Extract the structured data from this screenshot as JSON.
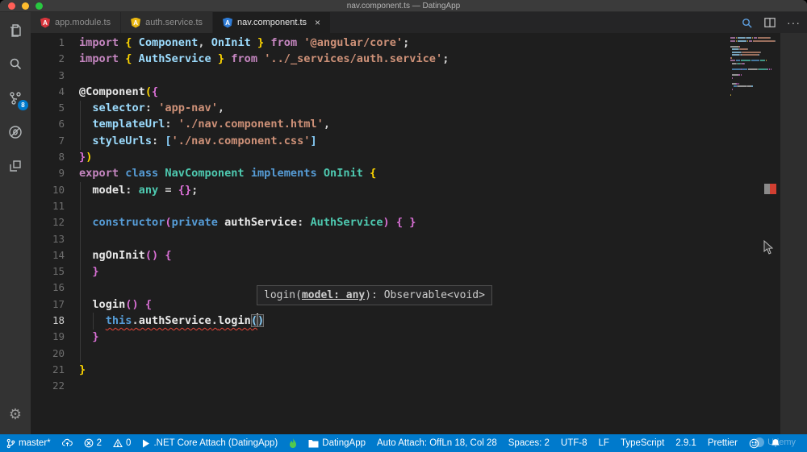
{
  "window": {
    "title": "nav.component.ts — DatingApp"
  },
  "tabs": [
    {
      "label": "app.module.ts",
      "icon_color": "#d8353c",
      "active": false
    },
    {
      "label": "auth.service.ts",
      "icon_color": "#e9b711",
      "active": false
    },
    {
      "label": "nav.component.ts",
      "icon_color": "#2f7cd6",
      "active": true,
      "close_label": "×"
    }
  ],
  "activity_bar": {
    "badge_count": "8",
    "items": [
      "explorer",
      "search",
      "source-control",
      "debug",
      "extensions"
    ],
    "settings": "gear"
  },
  "editor_actions": [
    "open-preview",
    "split-editor",
    "more-actions"
  ],
  "editor": {
    "active_line": 18,
    "lines": [
      {
        "tokens": [
          {
            "t": "import",
            "c": "kwp"
          },
          {
            "t": " ",
            "c": "pu"
          },
          {
            "t": "{",
            "c": "bg"
          },
          {
            "t": " ",
            "c": "pu"
          },
          {
            "t": "Component",
            "c": "vb"
          },
          {
            "t": ", ",
            "c": "pu"
          },
          {
            "t": "OnInit",
            "c": "vb"
          },
          {
            "t": " ",
            "c": "pu"
          },
          {
            "t": "}",
            "c": "bg"
          },
          {
            "t": " ",
            "c": "pu"
          },
          {
            "t": "from",
            "c": "kwp"
          },
          {
            "t": " ",
            "c": "pu"
          },
          {
            "t": "'@angular/core'",
            "c": "str"
          },
          {
            "t": ";",
            "c": "pu"
          }
        ]
      },
      {
        "tokens": [
          {
            "t": "import",
            "c": "kwp"
          },
          {
            "t": " ",
            "c": "pu"
          },
          {
            "t": "{",
            "c": "bg"
          },
          {
            "t": " ",
            "c": "pu"
          },
          {
            "t": "AuthService",
            "c": "vb"
          },
          {
            "t": " ",
            "c": "pu"
          },
          {
            "t": "}",
            "c": "bg"
          },
          {
            "t": " ",
            "c": "pu"
          },
          {
            "t": "from",
            "c": "kwp"
          },
          {
            "t": " ",
            "c": "pu"
          },
          {
            "t": "'../_services/auth.service'",
            "c": "str"
          },
          {
            "t": ";",
            "c": "pu"
          }
        ]
      },
      {
        "tokens": []
      },
      {
        "tokens": [
          {
            "t": "@Component",
            "c": "fn"
          },
          {
            "t": "(",
            "c": "bg"
          },
          {
            "t": "{",
            "c": "bp"
          }
        ]
      },
      {
        "tokens": [
          {
            "t": "  ",
            "c": "pu"
          },
          {
            "t": "selector",
            "c": "vb"
          },
          {
            "t": ": ",
            "c": "pu"
          },
          {
            "t": "'app-nav'",
            "c": "str"
          },
          {
            "t": ",",
            "c": "pu"
          }
        ]
      },
      {
        "tokens": [
          {
            "t": "  ",
            "c": "pu"
          },
          {
            "t": "templateUrl",
            "c": "vb"
          },
          {
            "t": ": ",
            "c": "pu"
          },
          {
            "t": "'./nav.component.html'",
            "c": "str"
          },
          {
            "t": ",",
            "c": "pu"
          }
        ]
      },
      {
        "tokens": [
          {
            "t": "  ",
            "c": "pu"
          },
          {
            "t": "styleUrls",
            "c": "vb"
          },
          {
            "t": ": ",
            "c": "pu"
          },
          {
            "t": "[",
            "c": "bb"
          },
          {
            "t": "'./nav.component.css'",
            "c": "str"
          },
          {
            "t": "]",
            "c": "bb"
          }
        ]
      },
      {
        "tokens": [
          {
            "t": "}",
            "c": "bp"
          },
          {
            "t": ")",
            "c": "bg"
          }
        ]
      },
      {
        "tokens": [
          {
            "t": "export",
            "c": "kwp"
          },
          {
            "t": " ",
            "c": "pu"
          },
          {
            "t": "class",
            "c": "kwb"
          },
          {
            "t": " ",
            "c": "pu"
          },
          {
            "t": "NavComponent",
            "c": "typ"
          },
          {
            "t": " ",
            "c": "pu"
          },
          {
            "t": "implements",
            "c": "kwb"
          },
          {
            "t": " ",
            "c": "pu"
          },
          {
            "t": "OnInit",
            "c": "typ"
          },
          {
            "t": " ",
            "c": "pu"
          },
          {
            "t": "{",
            "c": "bg"
          }
        ]
      },
      {
        "tokens": [
          {
            "t": "  ",
            "c": "pu"
          },
          {
            "t": "model",
            "c": "fn"
          },
          {
            "t": ": ",
            "c": "pu"
          },
          {
            "t": "any",
            "c": "typ"
          },
          {
            "t": " = ",
            "c": "pu"
          },
          {
            "t": "{}",
            "c": "bp"
          },
          {
            "t": ";",
            "c": "pu"
          }
        ]
      },
      {
        "tokens": []
      },
      {
        "tokens": [
          {
            "t": "  ",
            "c": "pu"
          },
          {
            "t": "constructor",
            "c": "kwb"
          },
          {
            "t": "(",
            "c": "bp"
          },
          {
            "t": "private",
            "c": "kwb"
          },
          {
            "t": " ",
            "c": "pu"
          },
          {
            "t": "authService",
            "c": "fn"
          },
          {
            "t": ": ",
            "c": "pu"
          },
          {
            "t": "AuthService",
            "c": "typ"
          },
          {
            "t": ")",
            "c": "bp"
          },
          {
            "t": " ",
            "c": "pu"
          },
          {
            "t": "{",
            "c": "bp"
          },
          {
            "t": " ",
            "c": "pu"
          },
          {
            "t": "}",
            "c": "bp"
          }
        ]
      },
      {
        "tokens": []
      },
      {
        "tokens": [
          {
            "t": "  ",
            "c": "pu"
          },
          {
            "t": "ngOnInit",
            "c": "fn"
          },
          {
            "t": "()",
            "c": "bp"
          },
          {
            "t": " ",
            "c": "pu"
          },
          {
            "t": "{",
            "c": "bp"
          }
        ]
      },
      {
        "tokens": [
          {
            "t": "  ",
            "c": "pu"
          },
          {
            "t": "}",
            "c": "bp"
          }
        ]
      },
      {
        "tokens": []
      },
      {
        "tokens": [
          {
            "t": "  ",
            "c": "pu"
          },
          {
            "t": "login",
            "c": "fn"
          },
          {
            "t": "()",
            "c": "bp"
          },
          {
            "t": " ",
            "c": "pu"
          },
          {
            "t": "{",
            "c": "bp"
          }
        ]
      },
      {
        "tokens": [
          {
            "t": "    ",
            "c": "pu"
          },
          {
            "t": "this",
            "c": "kwb",
            "u": 1
          },
          {
            "t": ".",
            "c": "pu",
            "u": 1
          },
          {
            "t": "authService",
            "c": "fn",
            "u": 1
          },
          {
            "t": ".",
            "c": "pu",
            "u": 1
          },
          {
            "t": "login",
            "c": "fn",
            "u": 1
          },
          {
            "t": "(",
            "c": "bb",
            "m": 1,
            "u": 1
          },
          {
            "cur": 1
          },
          {
            "t": ")",
            "c": "bb",
            "m": 1
          }
        ]
      },
      {
        "tokens": [
          {
            "t": "  ",
            "c": "pu"
          },
          {
            "t": "}",
            "c": "bp"
          }
        ]
      },
      {
        "tokens": []
      },
      {
        "tokens": [
          {
            "t": "}",
            "c": "bg"
          }
        ]
      },
      {
        "tokens": []
      }
    ]
  },
  "tooltip": {
    "pre": "login(",
    "param": "model: any",
    "post": "): Observable<void>"
  },
  "status_left": [
    {
      "icon": "branch",
      "text": "master*"
    },
    {
      "icon": "publish",
      "text": ""
    },
    {
      "icon": "errors",
      "text": "2"
    },
    {
      "icon": "warnings",
      "text": "0"
    },
    {
      "icon": "play",
      "text": ".NET Core Attach (DatingApp)"
    },
    {
      "icon": "flame",
      "text": ""
    },
    {
      "icon": "folder",
      "text": "DatingApp"
    },
    {
      "icon": "",
      "text": "Auto Attach: Off"
    }
  ],
  "status_right": [
    {
      "icon": "",
      "text": "Ln 18, Col 28"
    },
    {
      "icon": "",
      "text": "Spaces: 2"
    },
    {
      "icon": "",
      "text": "UTF-8"
    },
    {
      "icon": "",
      "text": "LF"
    },
    {
      "icon": "",
      "text": "TypeScript"
    },
    {
      "icon": "",
      "text": "2.9.1"
    },
    {
      "icon": "",
      "text": "Prettier"
    },
    {
      "icon": "smiley",
      "text": ""
    },
    {
      "icon": "bell",
      "text": ""
    }
  ],
  "watermark": {
    "text": "Udemy"
  },
  "colors": {
    "status_bar": "#007acc",
    "editor_bg": "#1e1e1e",
    "activity_bar": "#333333",
    "error_marker": "#d23f31",
    "badge": "#007acc",
    "token_map": {
      "kwp": "#c586c0",
      "kwb": "#569cd6",
      "typ": "#4ec9b0",
      "vb": "#9cdcfe",
      "fn": "#c8c8c8",
      "pu": "#8a8a8a",
      "str": "#ce9178",
      "bg": "#d7b542",
      "bp": "#da70d6",
      "bb": "#87cefa"
    }
  }
}
